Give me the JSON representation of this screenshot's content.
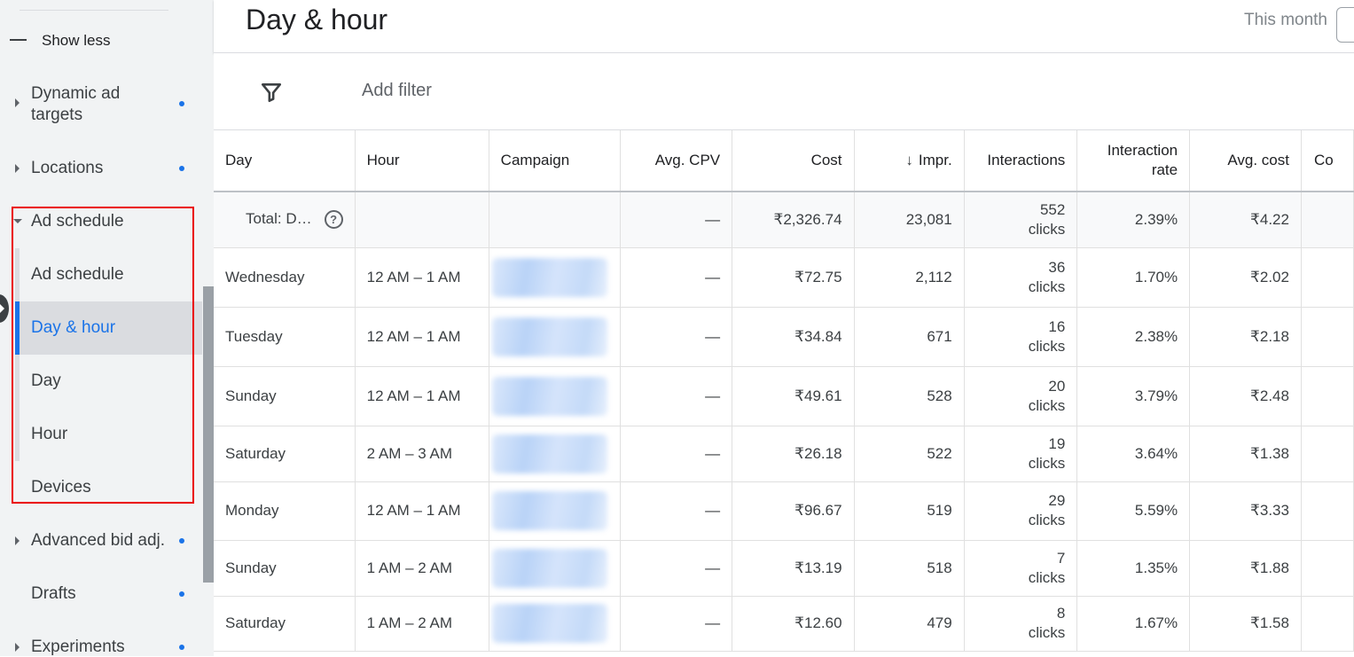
{
  "sidebar": {
    "show_less": "Show less",
    "items": [
      {
        "label_line1": "Dynamic ad",
        "label_line2": "targets"
      },
      {
        "label": "Locations"
      },
      {
        "label": "Ad schedule"
      },
      {
        "label": "Ad schedule"
      },
      {
        "label": "Day & hour"
      },
      {
        "label": "Day"
      },
      {
        "label": "Hour"
      },
      {
        "label": "Devices"
      },
      {
        "label": "Advanced bid adj."
      },
      {
        "label": "Drafts"
      },
      {
        "label": "Experiments"
      }
    ],
    "accent_color": "#1a73e8",
    "highlight_color": "#ea0000"
  },
  "header": {
    "title": "Day & hour",
    "date_range": "This month"
  },
  "filter": {
    "add_label": "Add filter"
  },
  "table": {
    "columns": [
      "Day",
      "Hour",
      "Campaign",
      "Avg. CPV",
      "Cost",
      "Impr.",
      "Interactions",
      "Interaction rate",
      "Avg. cost",
      "Co"
    ],
    "total": {
      "label": "Total: D…",
      "help": "?",
      "avg_cpv": "—",
      "cost": "₹2,326.74",
      "impr": "23,081",
      "interactions_num": "552",
      "interactions_unit": "clicks",
      "rate": "2.39%",
      "avg_cost": "₹4.22"
    },
    "rows": [
      {
        "day": "Wednesday",
        "hour": "12 AM – 1 AM",
        "avg_cpv": "—",
        "cost": "₹72.75",
        "impr": "2,112",
        "int_num": "36",
        "int_unit": "clicks",
        "rate": "1.70%",
        "avg_cost": "₹2.02"
      },
      {
        "day": "Tuesday",
        "hour": "12 AM – 1 AM",
        "avg_cpv": "—",
        "cost": "₹34.84",
        "impr": "671",
        "int_num": "16",
        "int_unit": "clicks",
        "rate": "2.38%",
        "avg_cost": "₹2.18"
      },
      {
        "day": "Sunday",
        "hour": "12 AM – 1 AM",
        "avg_cpv": "—",
        "cost": "₹49.61",
        "impr": "528",
        "int_num": "20",
        "int_unit": "clicks",
        "rate": "3.79%",
        "avg_cost": "₹2.48"
      },
      {
        "day": "Saturday",
        "hour": "2 AM – 3 AM",
        "avg_cpv": "—",
        "cost": "₹26.18",
        "impr": "522",
        "int_num": "19",
        "int_unit": "clicks",
        "rate": "3.64%",
        "avg_cost": "₹1.38"
      },
      {
        "day": "Monday",
        "hour": "12 AM – 1 AM",
        "avg_cpv": "—",
        "cost": "₹96.67",
        "impr": "519",
        "int_num": "29",
        "int_unit": "clicks",
        "rate": "5.59%",
        "avg_cost": "₹3.33"
      },
      {
        "day": "Sunday",
        "hour": "1 AM – 2 AM",
        "avg_cpv": "—",
        "cost": "₹13.19",
        "impr": "518",
        "int_num": "7",
        "int_unit": "clicks",
        "rate": "1.35%",
        "avg_cost": "₹1.88"
      },
      {
        "day": "Saturday",
        "hour": "1 AM – 2 AM",
        "avg_cpv": "—",
        "cost": "₹12.60",
        "impr": "479",
        "int_num": "8",
        "int_unit": "clicks",
        "rate": "1.67%",
        "avg_cost": "₹1.58"
      }
    ]
  }
}
